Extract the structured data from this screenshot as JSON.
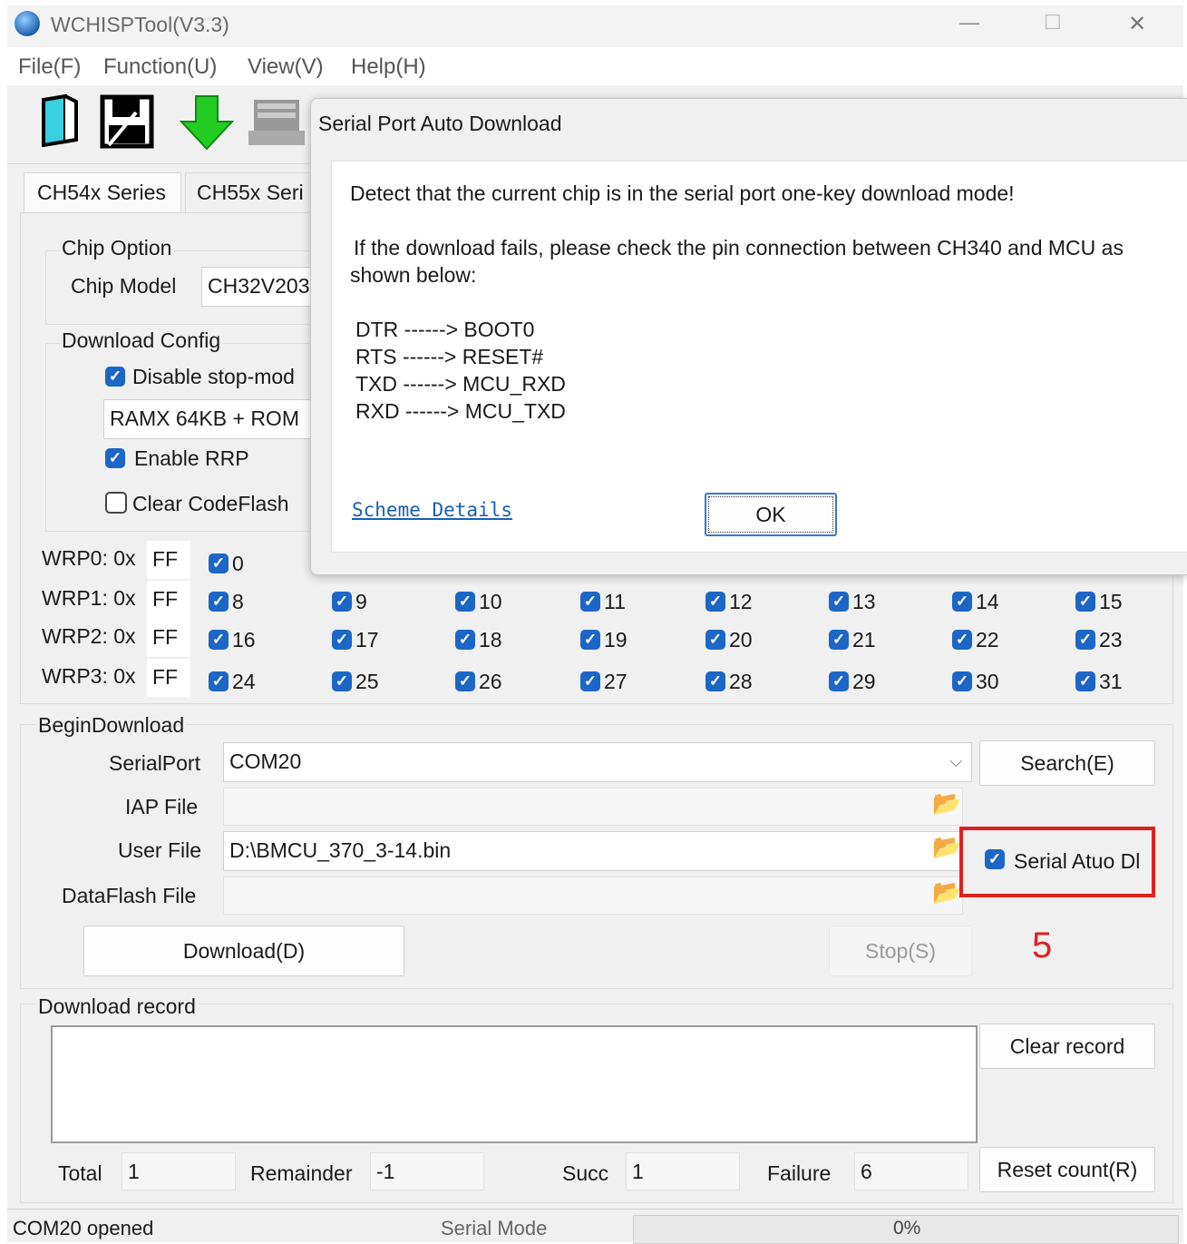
{
  "window": {
    "title": "WCHISPTool(V3.3)",
    "controls": {
      "minimize": "—",
      "maximize": "☐",
      "close": "✕"
    }
  },
  "menu": {
    "file": "File(F)",
    "function": "Function(U)",
    "view": "View(V)",
    "help": "Help(H)"
  },
  "tabs": [
    "CH54x Series",
    "CH55x Seri"
  ],
  "chip_option": {
    "group_label": "Chip Option",
    "model_label": "Chip Model",
    "model_value": "CH32V203"
  },
  "download_config": {
    "group_label": "Download Config",
    "disable_stop_mode": {
      "label": "Disable stop-mod",
      "checked": true
    },
    "memory_select": "RAMX 64KB + ROM",
    "enable_rrp": {
      "label": "Enable RRP",
      "checked": true
    },
    "clear_codeflash": {
      "label": "Clear CodeFlash",
      "checked": false
    }
  },
  "wrp": {
    "rows": [
      {
        "label": "WRP0: 0x",
        "value": "FF",
        "bits": [
          "0"
        ]
      },
      {
        "label": "WRP1: 0x",
        "value": "FF",
        "bits": [
          "8",
          "9",
          "10",
          "11",
          "12",
          "13",
          "14",
          "15"
        ]
      },
      {
        "label": "WRP2: 0x",
        "value": "FF",
        "bits": [
          "16",
          "17",
          "18",
          "19",
          "20",
          "21",
          "22",
          "23"
        ]
      },
      {
        "label": "WRP3: 0x",
        "value": "FF",
        "bits": [
          "24",
          "25",
          "26",
          "27",
          "28",
          "29",
          "30",
          "31"
        ]
      }
    ]
  },
  "begin_download": {
    "group_label": "BeginDownload",
    "serial_port_label": "SerialPort",
    "serial_port_value": "COM20",
    "search_button": "Search(E)",
    "iap_file_label": "IAP File",
    "iap_file_value": "",
    "user_file_label": "User File",
    "user_file_value": "D:\\BMCU_370_3-14.bin",
    "dataflash_label": "DataFlash File",
    "dataflash_value": "",
    "serial_auto_dl": {
      "label": "Serial Atuo Dl",
      "checked": true
    },
    "download_button": "Download(D)",
    "stop_button": "Stop(S)",
    "annotation_number": "5",
    "annotation_color": "#e02020"
  },
  "download_record": {
    "group_label": "Download record",
    "clear_button": "Clear record",
    "reset_button": "Reset count(R)",
    "total_label": "Total",
    "total_value": "1",
    "remainder_label": "Remainder",
    "remainder_value": "-1",
    "succ_label": "Succ",
    "succ_value": "1",
    "failure_label": "Failure",
    "failure_value": "6"
  },
  "status": {
    "port": "COM20 opened",
    "mode": "Serial Mode",
    "progress": "0%",
    "progress_fraction": 0
  },
  "dialog": {
    "title": "Serial Port Auto Download",
    "line1": "Detect that the current chip is in the serial port one-key download mode!",
    "line2a": "If the download fails, please check the pin connection between CH340 and MCU as",
    "line2b": "shown below:",
    "pins": [
      "DTR ------> BOOT0",
      "RTS ------> RESET#",
      "TXD ------> MCU_RXD",
      "RXD ------> MCU_TXD"
    ],
    "link": "Scheme Details",
    "ok_button": "OK"
  },
  "colors": {
    "accent": "#1c66c6",
    "annotation": "#e02020",
    "link": "#1a5fb4"
  }
}
